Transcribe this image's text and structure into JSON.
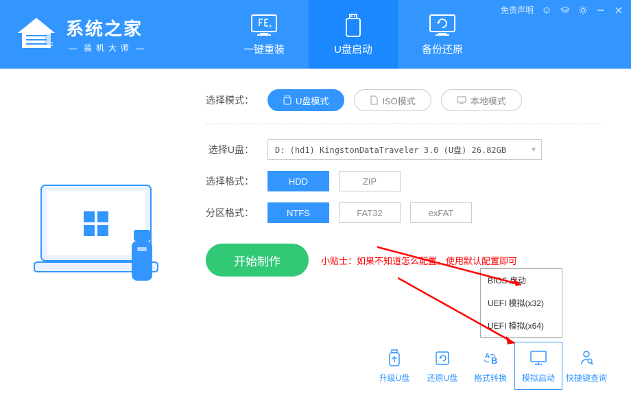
{
  "titlebar": {
    "disclaimer": "免责声明"
  },
  "logo": {
    "title": "系统之家",
    "subtitle": "装机大师"
  },
  "nav": {
    "items": [
      {
        "label": "一键重装"
      },
      {
        "label": "U盘启动"
      },
      {
        "label": "备份还原"
      }
    ],
    "active": 1
  },
  "mode": {
    "label": "选择模式：",
    "options": [
      {
        "label": "U盘模式",
        "active": true
      },
      {
        "label": "ISO模式",
        "active": false
      },
      {
        "label": "本地模式",
        "active": false
      }
    ]
  },
  "usb": {
    "label": "选择U盘：",
    "selected": "D: (hd1) KingstonDataTraveler 3.0 (U盘) 26.82GB"
  },
  "format": {
    "label": "选择格式：",
    "options": [
      {
        "label": "HDD",
        "active": true
      },
      {
        "label": "ZIP",
        "active": false
      }
    ]
  },
  "partition": {
    "label": "分区格式：",
    "options": [
      {
        "label": "NTFS",
        "active": true
      },
      {
        "label": "FAT32",
        "active": false
      },
      {
        "label": "exFAT",
        "active": false
      }
    ]
  },
  "start_button": "开始制作",
  "tip": "小贴士：如果不知道怎么配置，使用默认配置即可",
  "popup": {
    "items": [
      "BIOS 启动",
      "UEFI 模拟(x32)",
      "UEFI 模拟(x64)"
    ]
  },
  "bottom_actions": [
    {
      "label": "升级U盘"
    },
    {
      "label": "还原U盘"
    },
    {
      "label": "格式转换"
    },
    {
      "label": "模拟启动"
    },
    {
      "label": "快捷键查询"
    }
  ],
  "colors": {
    "primary": "#3396ff",
    "success": "#31c976",
    "danger": "#ff0000"
  }
}
